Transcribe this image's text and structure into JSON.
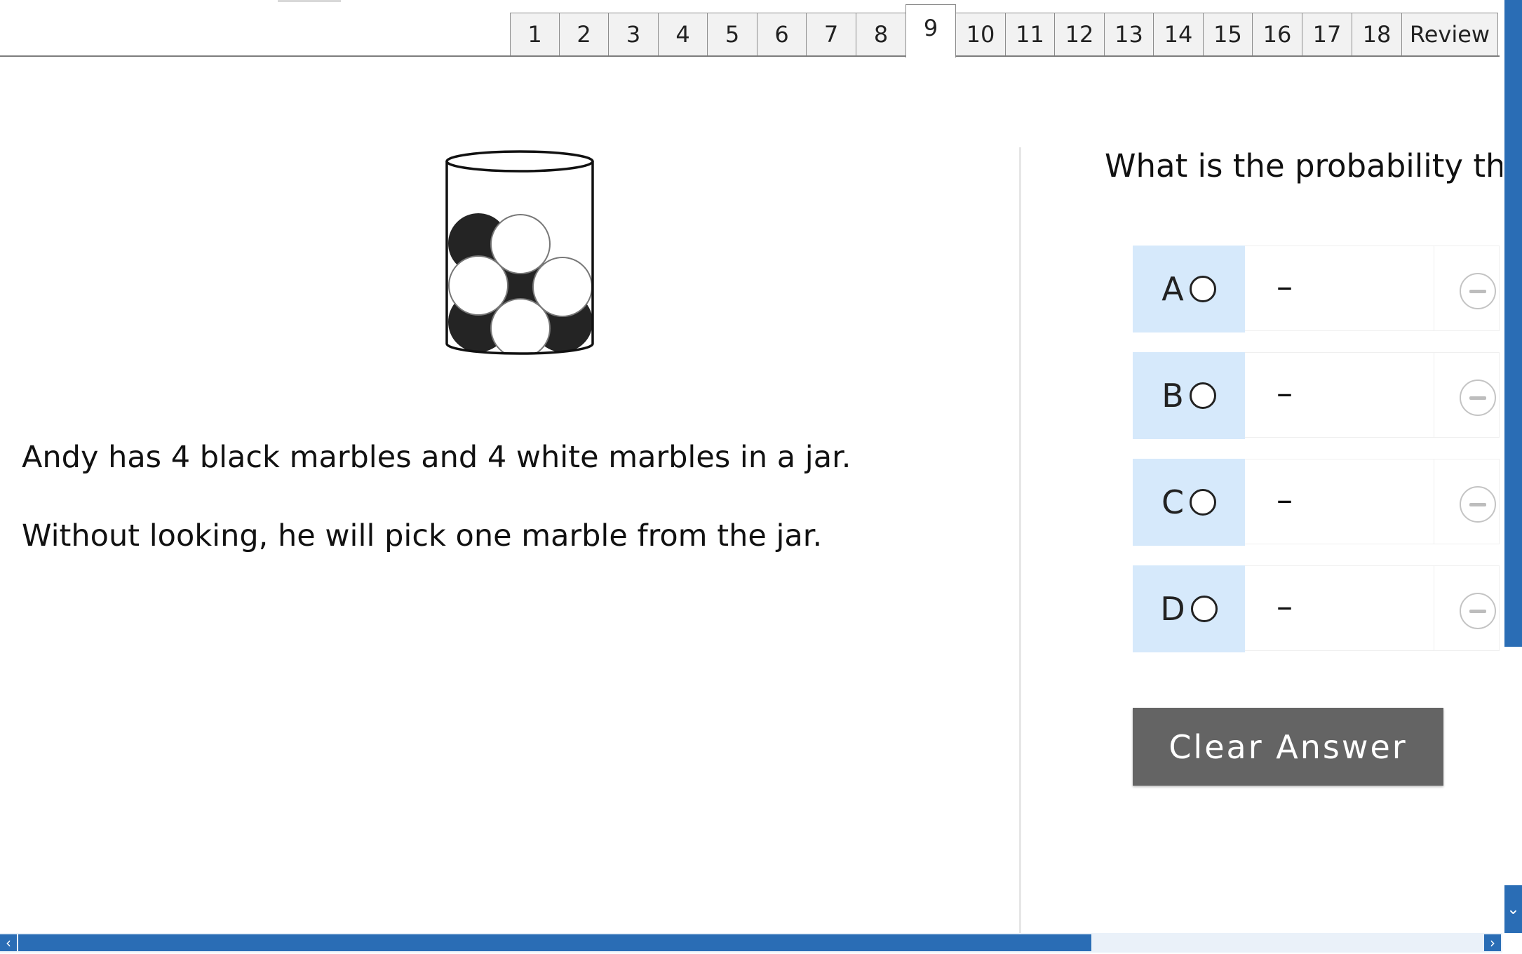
{
  "tabs": [
    "1",
    "2",
    "3",
    "4",
    "5",
    "6",
    "7",
    "8",
    "9",
    "10",
    "11",
    "12",
    "13",
    "14",
    "15",
    "16",
    "17",
    "18",
    "Review"
  ],
  "active_tab": "9",
  "stem": {
    "line1": "Andy has 4 black marbles and 4 white marbles in a jar.",
    "line2": "Without looking, he will pick one marble from the jar."
  },
  "question": "What is the probability that",
  "options": [
    {
      "letter": "A",
      "value": "–"
    },
    {
      "letter": "B",
      "value": "–"
    },
    {
      "letter": "C",
      "value": "–"
    },
    {
      "letter": "D",
      "value": "–"
    }
  ],
  "clear_button": "Clear Answer",
  "icons": {
    "radio": "radio-unselected-icon",
    "strike": "strikethrough-minus-icon",
    "scroll_down": "chevron-down-icon",
    "scroll_left": "chevron-left-icon",
    "scroll_right": "chevron-right-icon"
  },
  "colors": {
    "accent": "#2a6db5",
    "option_label_bg": "#d6e9fb",
    "button_bg": "#646464"
  }
}
